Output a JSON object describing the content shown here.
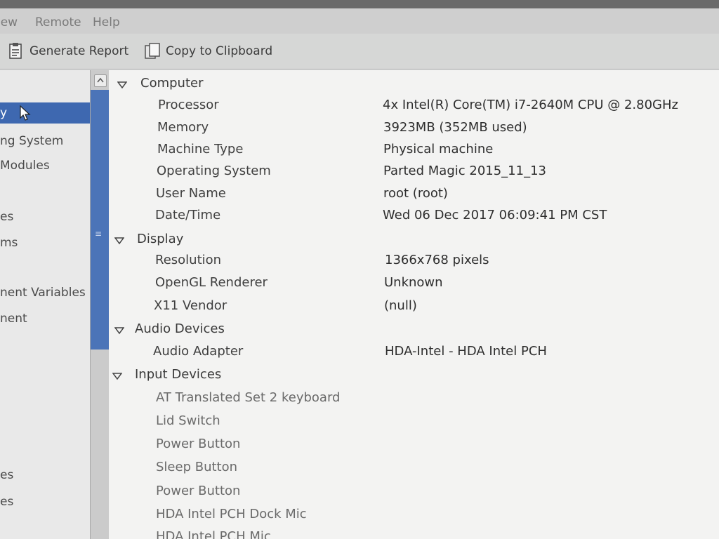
{
  "menu": {
    "items": [
      {
        "label": "iew",
        "mnemonic_index": -1
      },
      {
        "label": "Remote",
        "mnemonic_index": 0
      },
      {
        "label": "Help",
        "mnemonic_index": 0
      }
    ]
  },
  "toolbar": {
    "generate_report_label": "Generate Report",
    "copy_clipboard_label": "Copy to Clipboard"
  },
  "sidebar": {
    "items": [
      {
        "label": "y",
        "selected": true
      },
      {
        "label": "ng System"
      },
      {
        "label": "Modules"
      },
      {
        "label": "es"
      },
      {
        "label": "ms"
      },
      {
        "label": "nent Variables"
      },
      {
        "label": "nent"
      },
      {
        "label": "es"
      },
      {
        "label": "es"
      }
    ]
  },
  "computer": {
    "category": "Computer",
    "processor_key": "Processor",
    "processor_value": "4x Intel(R) Core(TM) i7-2640M CPU @ 2.80GHz",
    "memory_key": "Memory",
    "memory_value": "3923MB (352MB used)",
    "machine_type_key": "Machine Type",
    "machine_type_value": "Physical machine",
    "os_key": "Operating System",
    "os_value": "Parted Magic 2015_11_13",
    "user_key": "User Name",
    "user_value": "root (root)",
    "datetime_key": "Date/Time",
    "datetime_value": "Wed 06 Dec 2017 06:09:41 PM CST"
  },
  "display": {
    "category": "Display",
    "resolution_key": "Resolution",
    "resolution_value": "1366x768 pixels",
    "opengl_key": "OpenGL Renderer",
    "opengl_value": "Unknown",
    "x11_key": "X11 Vendor",
    "x11_value": "(null)"
  },
  "audio": {
    "category": "Audio Devices",
    "adapter_key": "Audio Adapter",
    "adapter_value": "HDA-Intel - HDA Intel PCH"
  },
  "input": {
    "category": "Input Devices",
    "devices": [
      "AT Translated Set 2 keyboard",
      "Lid Switch",
      "Power Button",
      "Sleep Button",
      "Power Button",
      "HDA Intel PCH Dock Mic",
      "HDA Intel PCH Mic"
    ]
  },
  "colors": {
    "selection": "#3e68b0",
    "content_bg": "#f3f3f2",
    "toolbar_bg": "#d6d7d6"
  }
}
